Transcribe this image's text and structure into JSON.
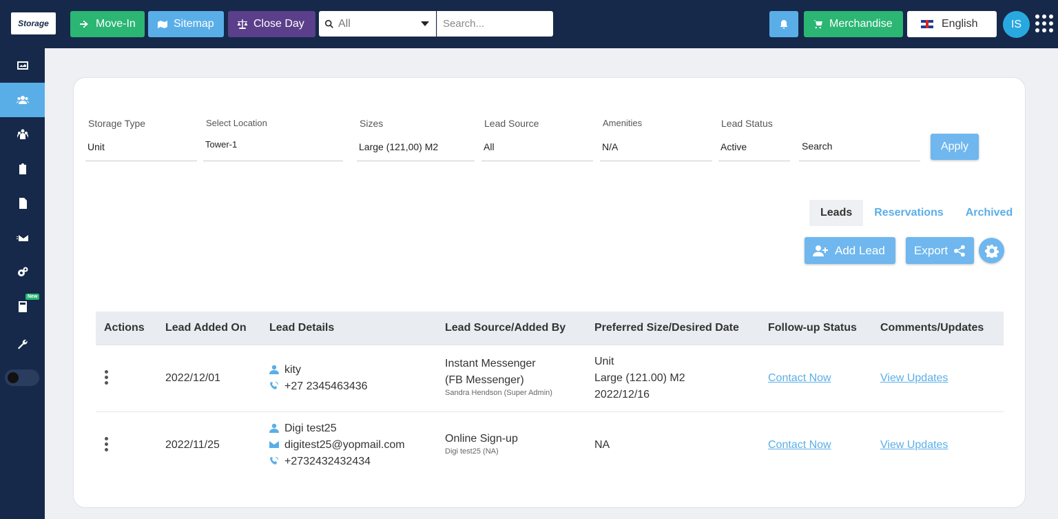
{
  "topbar": {
    "logo_text": "Storage",
    "move_in": "Move-In",
    "sitemap": "Sitemap",
    "close_day": "Close Day",
    "search_scope": "All",
    "search_placeholder": "Search...",
    "merchandise": "Merchandise",
    "language": "English",
    "avatar_initials": "IS"
  },
  "sidebar": {
    "new_badge": "New",
    "items": [
      "dashboard-icon",
      "users-icon",
      "group-icon",
      "clipboard-icon",
      "document-icon",
      "mail-icon",
      "gears-icon",
      "calculator-icon",
      "wrench-icon"
    ]
  },
  "filters": {
    "storage_type": {
      "label": "Storage Type",
      "value": "Unit"
    },
    "location": {
      "label": "Select Location",
      "value": "Tower-1"
    },
    "sizes": {
      "label": "Sizes",
      "value": "Large (121,00) M2"
    },
    "lead_source": {
      "label": "Lead Source",
      "value": "All"
    },
    "amenities": {
      "label": "Amenities",
      "value": "N/A"
    },
    "lead_status": {
      "label": "Lead Status",
      "value": "Active"
    },
    "search": {
      "placeholder": "Search"
    },
    "apply": "Apply"
  },
  "tabs": [
    "Leads",
    "Reservations",
    "Archived"
  ],
  "actions": {
    "add_lead": "Add Lead",
    "export": "Export"
  },
  "table": {
    "headers": [
      "Actions",
      "Lead Added On",
      "Lead Details",
      "Lead Source/Added By",
      "Preferred Size/Desired Date",
      "Follow-up Status",
      "Comments/Updates"
    ],
    "rows": [
      {
        "date": "2022/12/01",
        "name": "kity",
        "email": "",
        "phone": "+27 2345463436",
        "source_line1": "Instant Messenger",
        "source_line2": "(FB Messenger)",
        "added_by": "Sandra Hendson (Super Admin)",
        "pref_line1": "Unit",
        "pref_line2": "Large (121.00) M2",
        "pref_line3": "2022/12/16",
        "followup": "Contact Now",
        "comments": "View Updates"
      },
      {
        "date": "2022/11/25",
        "name": "Digi test25",
        "email": "digitest25@yopmail.com",
        "phone": "+2732432432434",
        "source_line1": "Online Sign-up",
        "source_line2": "",
        "added_by": "Digi test25 (NA)",
        "pref_line1": "NA",
        "pref_line2": "",
        "pref_line3": "",
        "followup": "Contact Now",
        "comments": "View Updates"
      }
    ]
  }
}
